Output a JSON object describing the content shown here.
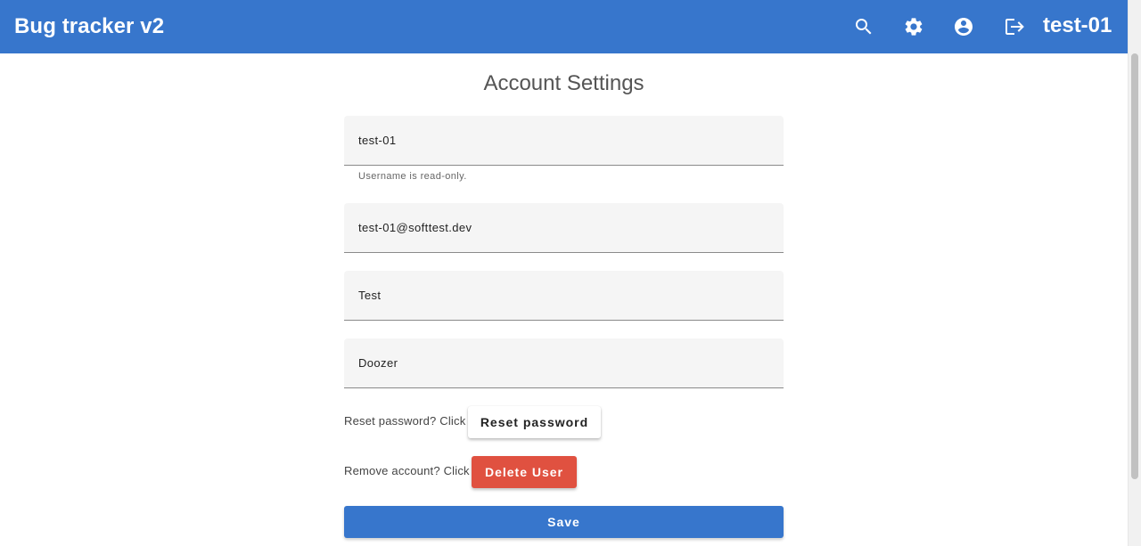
{
  "appbar": {
    "title": "Bug tracker v2",
    "user": "test-01",
    "icons": [
      "search-icon",
      "gear-icon",
      "account-circle-icon",
      "logout-icon"
    ]
  },
  "page": {
    "title": "Account Settings"
  },
  "form": {
    "username": {
      "value": "test-01",
      "hint": "Username is read-only."
    },
    "email": {
      "value": "test-01@softtest.dev"
    },
    "first_name": {
      "value": "Test"
    },
    "last_name": {
      "value": "Doozer"
    },
    "reset_prompt": "Reset password? Click",
    "reset_button": "Reset password",
    "remove_prompt": "Remove account? Click",
    "delete_button": "Delete User",
    "save_button": "Save"
  },
  "colors": {
    "primary": "#3776cc",
    "danger": "#e05140",
    "field_bg": "#f5f5f5"
  }
}
